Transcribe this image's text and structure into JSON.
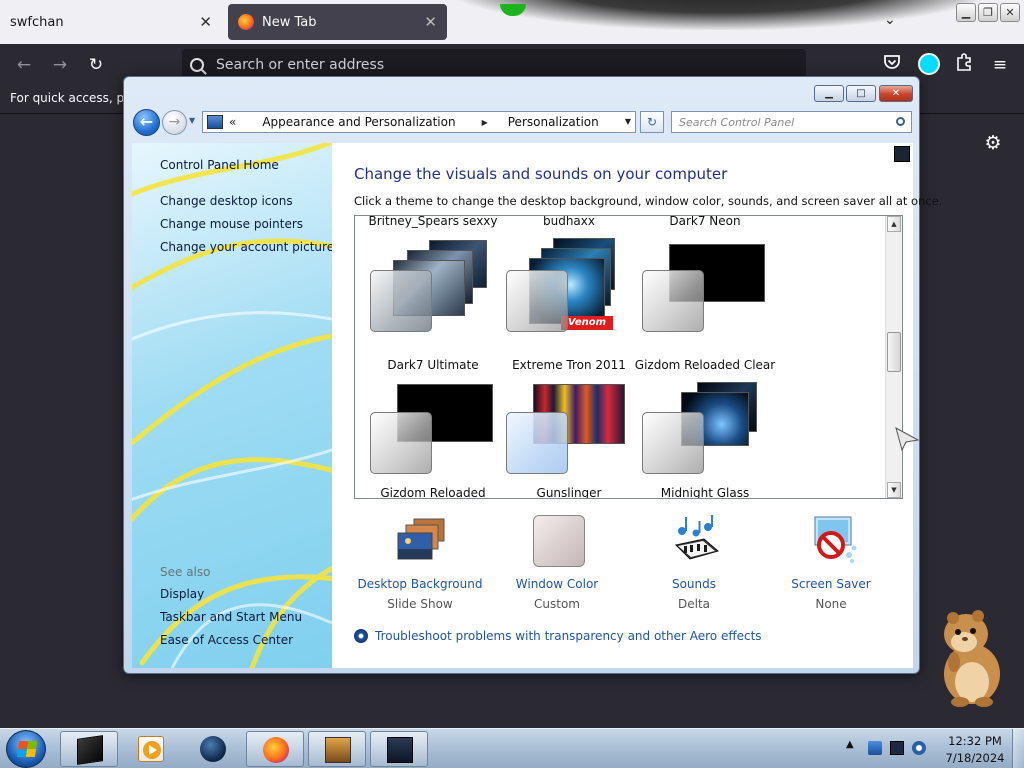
{
  "browser": {
    "tabs": [
      {
        "title": "swfchan",
        "close": "✕"
      },
      {
        "title": "New Tab",
        "close": "✕"
      }
    ],
    "tab_list_glyph": "⌄",
    "address_placeholder": "Search or enter address",
    "bookmarks_hint": "For quick access, plac",
    "icons": {
      "back": "arrow-left-icon",
      "forward": "arrow-right-icon",
      "reload": "reload-icon",
      "pocket": "pocket-icon",
      "account": "account-icon",
      "extensions": "puzzle-icon",
      "menu": "hamburger-icon",
      "settings": "gear-icon"
    }
  },
  "control_panel": {
    "breadcrumb": {
      "chevron": "«",
      "items": [
        "Appearance and Personalization",
        "Personalization"
      ]
    },
    "search_placeholder": "Search Control Panel",
    "left_pane": {
      "home": "Control Panel Home",
      "links": [
        "Change desktop icons",
        "Change mouse pointers",
        "Change your account picture"
      ],
      "see_also_heading": "See also",
      "see_also": [
        "Display",
        "Taskbar and Start Menu",
        "Ease of Access Center"
      ]
    },
    "main": {
      "title": "Change the visuals and sounds on your computer",
      "subtitle": "Click a theme to change the desktop background, window color, sounds, and screen saver all at once.",
      "top_row_labels": [
        "Britney_Spears sexxy",
        "budhaxx",
        "Dark7 Neon"
      ],
      "themes": [
        {
          "name": "Dark7 Ultimate"
        },
        {
          "name": "Extreme Tron 2011"
        },
        {
          "name": "Gizdom Reloaded Clear"
        },
        {
          "name": "Gizdom Reloaded"
        },
        {
          "name": "Gunslinger"
        },
        {
          "name": "Midnight Glass"
        }
      ],
      "options": [
        {
          "label": "Desktop Background",
          "value": "Slide Show",
          "icon": "desktop-background-icon"
        },
        {
          "label": "Window Color",
          "value": "Custom",
          "icon": "window-color-icon"
        },
        {
          "label": "Sounds",
          "value": "Delta",
          "icon": "sounds-icon"
        },
        {
          "label": "Screen Saver",
          "value": "None",
          "icon": "screen-saver-icon"
        }
      ],
      "troubleshoot": "Troubleshoot problems with transparency and other Aero effects"
    },
    "colors": {
      "title": "#1e3287",
      "link": "#1e54a8"
    }
  },
  "taskbar": {
    "time": "12:32 PM",
    "date": "7/18/2024",
    "tray_arrow": "▲"
  }
}
